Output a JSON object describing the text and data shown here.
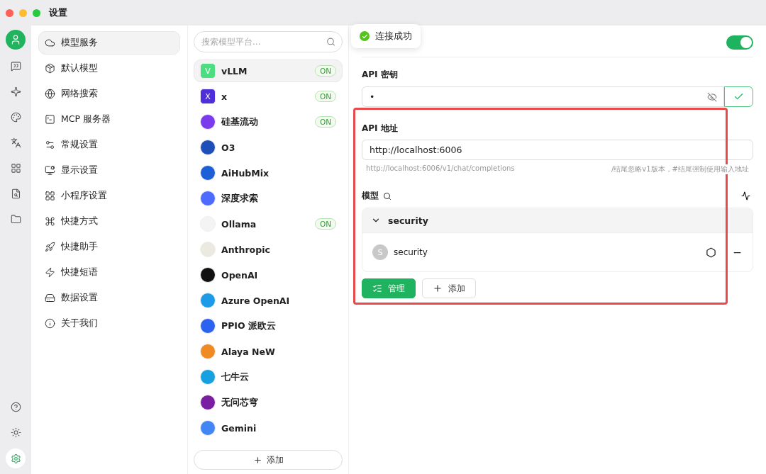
{
  "window": {
    "title": "设置"
  },
  "rail": {
    "items": [
      {
        "kind": "chat",
        "selected": false
      },
      {
        "kind": "sparkle",
        "selected": false
      },
      {
        "kind": "palette",
        "selected": false
      },
      {
        "kind": "translate",
        "selected": false
      },
      {
        "kind": "apps",
        "selected": false
      },
      {
        "kind": "files",
        "selected": false
      },
      {
        "kind": "folder",
        "selected": false
      }
    ],
    "bottom": [
      {
        "kind": "help",
        "selected": false
      },
      {
        "kind": "theme",
        "selected": false
      },
      {
        "kind": "settings",
        "selected": true
      }
    ]
  },
  "settings_nav": [
    {
      "label": "模型服务",
      "selected": true
    },
    {
      "label": "默认模型",
      "selected": false
    },
    {
      "label": "网络搜索",
      "selected": false
    },
    {
      "label": "MCP 服务器",
      "selected": false
    },
    {
      "label": "常规设置",
      "selected": false
    },
    {
      "label": "显示设置",
      "selected": false
    },
    {
      "label": "小程序设置",
      "selected": false
    },
    {
      "label": "快捷方式",
      "selected": false
    },
    {
      "label": "快捷助手",
      "selected": false
    },
    {
      "label": "快捷短语",
      "selected": false
    },
    {
      "label": "数据设置",
      "selected": false
    },
    {
      "label": "关于我们",
      "selected": false
    }
  ],
  "providers": {
    "search": {
      "placeholder": "搜索模型平台..."
    },
    "items": [
      {
        "name": "vLLM",
        "logo_text": "V",
        "color": "#4ade80",
        "badge": "ON",
        "selected": true
      },
      {
        "name": "x",
        "logo_text": "X",
        "color": "#4f2fd9",
        "badge": "ON",
        "selected": false
      },
      {
        "name": "硅基流动",
        "color": "#7c3aed",
        "badge": "ON",
        "selected": false
      },
      {
        "name": "O3",
        "color": "#1e4fb8",
        "selected": false
      },
      {
        "name": "AiHubMix",
        "color": "#1d5fd6",
        "selected": false
      },
      {
        "name": "深度求索",
        "color": "#4d6bfe",
        "selected": false
      },
      {
        "name": "Ollama",
        "color": "#f4f4f4",
        "badge": "ON",
        "selected": false
      },
      {
        "name": "Anthropic",
        "color": "#ece9e1",
        "selected": false
      },
      {
        "name": "OpenAI",
        "color": "#111111",
        "selected": false
      },
      {
        "name": "Azure OpenAI",
        "color": "#1e9be8",
        "selected": false
      },
      {
        "name": "PPIO 派欧云",
        "color": "#2b62f0",
        "selected": false
      },
      {
        "name": "Alaya NeW",
        "color": "#f08a24",
        "selected": false
      },
      {
        "name": "七牛云",
        "color": "#16a0e0",
        "selected": false
      },
      {
        "name": "无问芯穹",
        "color": "#7a1fa2",
        "selected": false
      },
      {
        "name": "Gemini",
        "color": "#4285f4",
        "selected": false
      }
    ],
    "add_button": "添加"
  },
  "toast": {
    "message": "连接成功"
  },
  "detail": {
    "enabled": true,
    "api_key": {
      "label": "API 密钥",
      "value": "•"
    },
    "api_host": {
      "label": "API 地址",
      "value": "http://localhost:6006",
      "preview": "http://localhost:6006/v1/chat/completions",
      "hint": "/结尾忽略v1版本，#结尾强制使用输入地址"
    },
    "models": {
      "label": "模型",
      "groups": [
        {
          "name": "security",
          "expanded": true,
          "models": [
            {
              "avatar": "S",
              "name": "security"
            }
          ]
        }
      ]
    },
    "buttons": [
      {
        "kind": "primary",
        "label": "管理"
      },
      {
        "kind": "secondary",
        "label": "添加"
      }
    ]
  }
}
